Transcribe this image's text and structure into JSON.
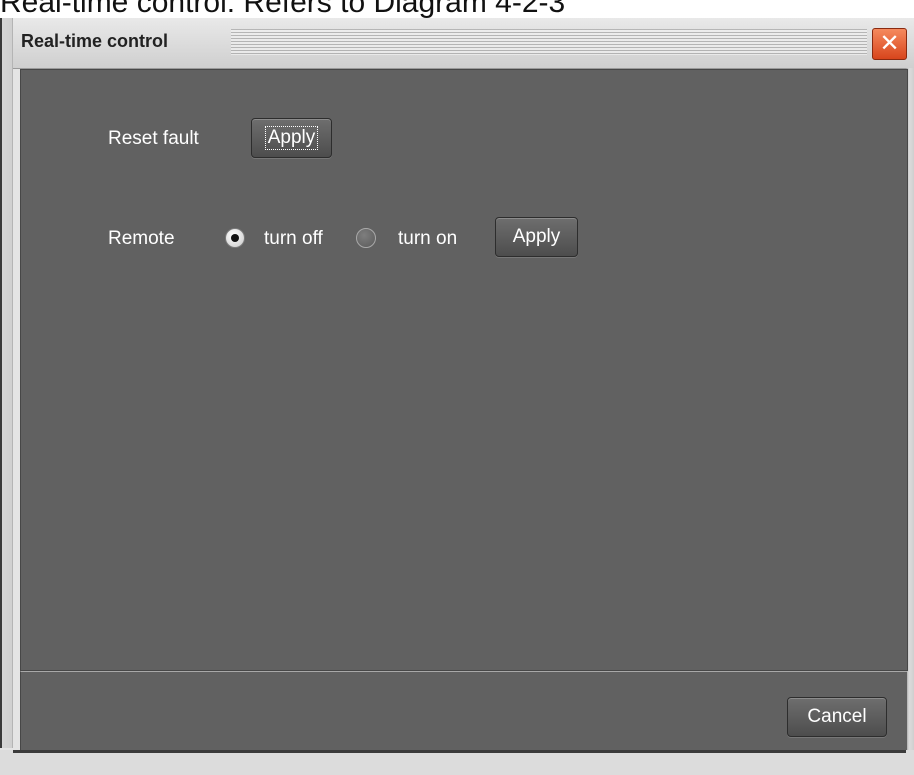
{
  "caption": "Real-time control: Refers to Diagram 4-2-3",
  "window": {
    "title": "Real-time control",
    "close_glyph": "✕"
  },
  "reset_fault": {
    "label": "Reset fault",
    "apply_label": "Apply"
  },
  "remote": {
    "label": "Remote",
    "options": [
      {
        "label": "turn off",
        "selected": true
      },
      {
        "label": "turn on",
        "selected": false
      }
    ],
    "apply_label": "Apply"
  },
  "footer": {
    "cancel_label": "Cancel"
  },
  "icons": {
    "close": "close-icon"
  },
  "colors": {
    "panel": "#616161",
    "close_button": "#e0562a"
  }
}
